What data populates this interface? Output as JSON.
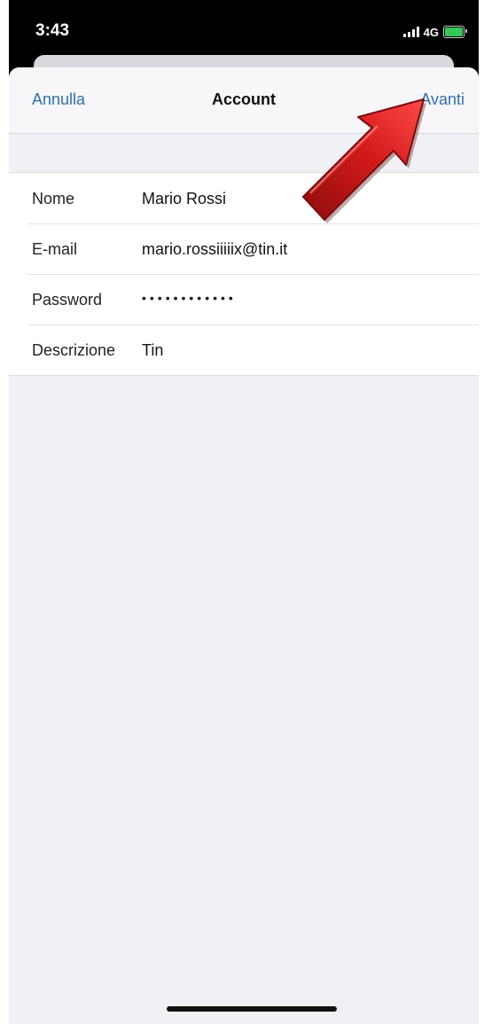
{
  "status_bar": {
    "time": "3:43",
    "network": "4G",
    "icons": [
      "signal-icon",
      "battery-icon"
    ],
    "battery_color": "#34c759"
  },
  "nav": {
    "cancel_label": "Annulla",
    "title": "Account",
    "next_label": "Avanti",
    "accent_color": "#2f6fb3"
  },
  "form": {
    "rows": [
      {
        "label": "Nome",
        "value": "Mario Rossi"
      },
      {
        "label": "E-mail",
        "value": "mario.rossiiiiix@tin.it"
      },
      {
        "label": "Password",
        "value": "••••••••••••"
      },
      {
        "label": "Descrizione",
        "value": "Tin"
      }
    ]
  },
  "annotation": {
    "icon": "red-arrow-icon",
    "color": "#d41a1a"
  }
}
